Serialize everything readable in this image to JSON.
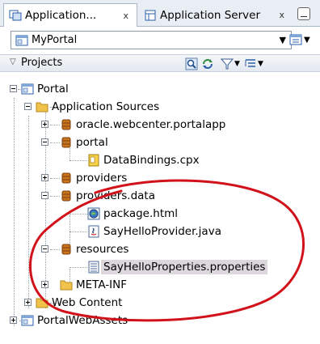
{
  "tabs": [
    {
      "label": "Application...",
      "close": "x"
    },
    {
      "label": "Application Server",
      "close": "x"
    }
  ],
  "portal_selector": {
    "value": "MyPortal"
  },
  "panel": {
    "title": "Projects"
  },
  "tree": {
    "portal": "Portal",
    "application_sources": "Application Sources",
    "pkg_webcenter": "oracle.webcenter.portalapp",
    "pkg_portal": "portal",
    "file_databindings": "DataBindings.cpx",
    "pkg_providers": "providers",
    "pkg_providers_data": "providers.data",
    "file_package_html": "package.html",
    "file_sayhello_java": "SayHelloProvider.java",
    "pkg_resources": "resources",
    "file_properties": "SayHelloProperties.properties",
    "folder_meta_inf": "META-INF",
    "web_content": "Web Content",
    "portal_web_assets": "PortalWebAssets"
  },
  "colors": {
    "annotation": "#d2121b",
    "selection": "#dcd7dd",
    "folder": "#f1c24b",
    "package": "#c8731d"
  }
}
